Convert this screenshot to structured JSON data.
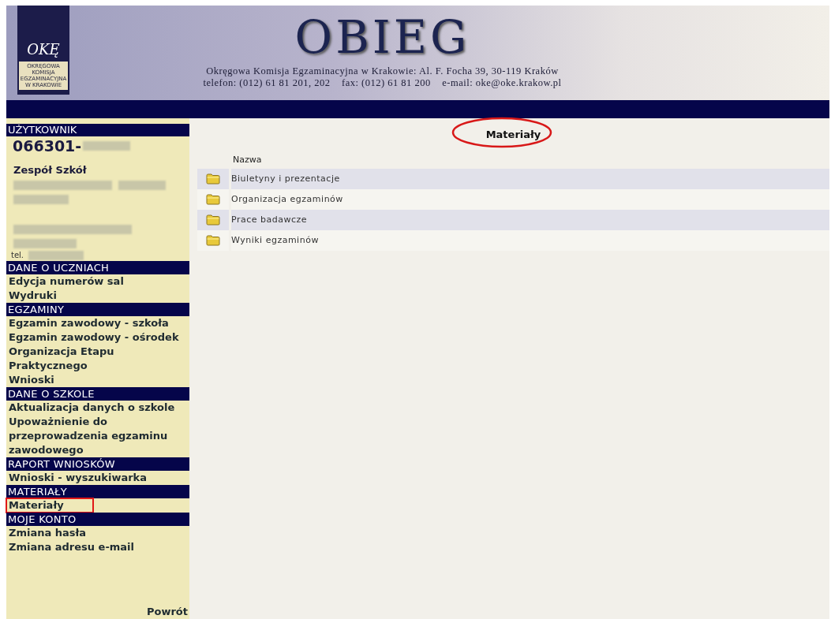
{
  "header": {
    "logo": {
      "mark": "OKĘ",
      "lines": [
        "OKRĘGOWA",
        "KOMISJA",
        "EGZAMINACYJNA",
        "W KRAKOWIE"
      ]
    },
    "title": "OBIEG",
    "address_lines": [
      "Okręgowa Komisja Egzaminacyjna w Krakowie: Al. F. Focha 39, 30-119 Kraków",
      "telefon: (012) 61 81 201, 202    fax: (012) 61 81 200    e-mail: oke@oke.krakow.pl"
    ]
  },
  "user": {
    "heading": "UŻYTKOWNIK",
    "code": "066301-",
    "school": "Zespół Szkół",
    "phone_label": "tel."
  },
  "sidebar": {
    "sections": [
      {
        "heading": "DANE O UCZNIACH",
        "items": [
          {
            "label": "Edycja numerów sal",
            "boxed": false
          },
          {
            "label": "Wydruki",
            "boxed": false
          }
        ]
      },
      {
        "heading": "EGZAMINY",
        "items": [
          {
            "label": "Egzamin zawodowy - szkoła",
            "boxed": false
          },
          {
            "label": "Egzamin zawodowy - ośrodek",
            "boxed": false
          },
          {
            "label": "Organizacja Etapu Praktycznego",
            "boxed": false
          },
          {
            "label": "Wnioski",
            "boxed": false
          }
        ]
      },
      {
        "heading": "DANE O SZKOLE",
        "items": [
          {
            "label": "Aktualizacja danych o szkole",
            "boxed": false
          },
          {
            "label": "Upoważnienie do przeprowadzenia egzaminu zawodowego",
            "boxed": false
          }
        ]
      },
      {
        "heading": "RAPORT WNIOSKÓW",
        "items": [
          {
            "label": "Wnioski - wyszukiwarka",
            "boxed": false
          }
        ]
      },
      {
        "heading": "MATERIAŁY",
        "items": [
          {
            "label": "Materiały",
            "boxed": true
          }
        ]
      },
      {
        "heading": "MOJE KONTO",
        "items": [
          {
            "label": "Zmiana hasła",
            "boxed": false
          },
          {
            "label": "Zmiana adresu e-mail",
            "boxed": false
          }
        ]
      }
    ],
    "back_link": "Powrót"
  },
  "main": {
    "title": "Materiały",
    "title_circled": true,
    "column": "Nazwa",
    "folders": [
      {
        "name": "Biuletyny i prezentacje"
      },
      {
        "name": "Organizacja egzaminów"
      },
      {
        "name": "Prace badawcze"
      },
      {
        "name": "Wyniki egzaminów"
      }
    ]
  }
}
